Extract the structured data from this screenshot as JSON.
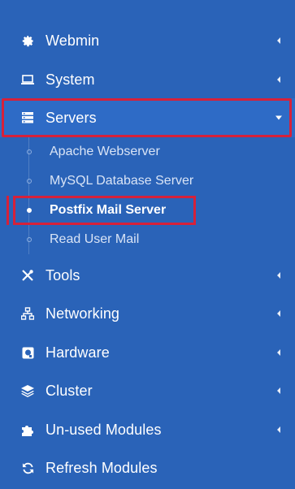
{
  "menu": {
    "top_items": [
      {
        "label": "Webmin",
        "icon": "gear-icon"
      },
      {
        "label": "System",
        "icon": "laptop-icon"
      },
      {
        "label": "Servers",
        "icon": "server-icon",
        "expanded": true
      }
    ],
    "servers_sub": [
      {
        "label": "Apache Webserver"
      },
      {
        "label": "MySQL Database Server"
      },
      {
        "label": "Postfix Mail Server",
        "active": true
      },
      {
        "label": "Read User Mail"
      }
    ],
    "bottom_items": [
      {
        "label": "Tools",
        "icon": "tools-icon"
      },
      {
        "label": "Networking",
        "icon": "network-icon"
      },
      {
        "label": "Hardware",
        "icon": "hardware-icon"
      },
      {
        "label": "Cluster",
        "icon": "layers-icon"
      },
      {
        "label": "Un-used Modules",
        "icon": "puzzle-icon"
      },
      {
        "label": "Refresh Modules",
        "icon": "refresh-icon"
      }
    ]
  },
  "colors": {
    "background": "#2a63b8",
    "highlight_border": "#d6213a",
    "text": "#ffffff"
  }
}
